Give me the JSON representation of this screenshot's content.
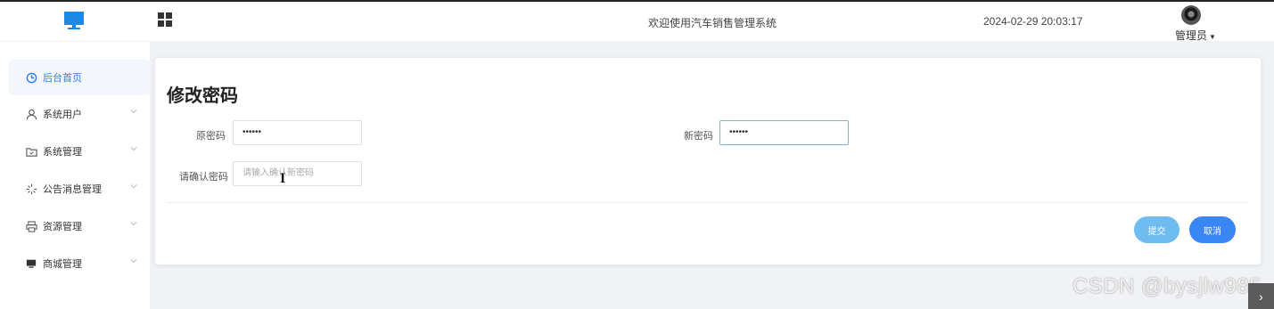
{
  "header": {
    "system_title": "欢迎使用汽车销售管理系统",
    "datetime": "2024-02-29 20:03:17",
    "user_label": "管理员",
    "logo_icon": "monitor-icon",
    "menu_toggle_icon": "grid-icon"
  },
  "sidebar": {
    "items": [
      {
        "label": "后台首页",
        "icon": "clock-icon",
        "active": true
      },
      {
        "label": "系统用户",
        "icon": "user-icon",
        "active": false
      },
      {
        "label": "系统管理",
        "icon": "folder-icon",
        "active": false
      },
      {
        "label": "公告消息管理",
        "icon": "spinner-icon",
        "active": false
      },
      {
        "label": "资源管理",
        "icon": "printer-icon",
        "active": false
      },
      {
        "label": "商城管理",
        "icon": "monitor-icon",
        "active": false
      }
    ]
  },
  "form": {
    "title": "修改密码",
    "old_password": {
      "label": "原密码",
      "value": "••••••"
    },
    "new_password": {
      "label": "新密码",
      "value": "••••••"
    },
    "confirm_password": {
      "label": "请确认密码",
      "placeholder": "请输入确认新密码"
    },
    "submit_label": "提交",
    "cancel_label": "取消"
  },
  "watermark": "CSDN @bysjlw985",
  "colors": {
    "accent": "#2d7cf4",
    "submit": "#6ebcf0",
    "cancel": "#3b86f5",
    "logo": "#1e88e5"
  }
}
